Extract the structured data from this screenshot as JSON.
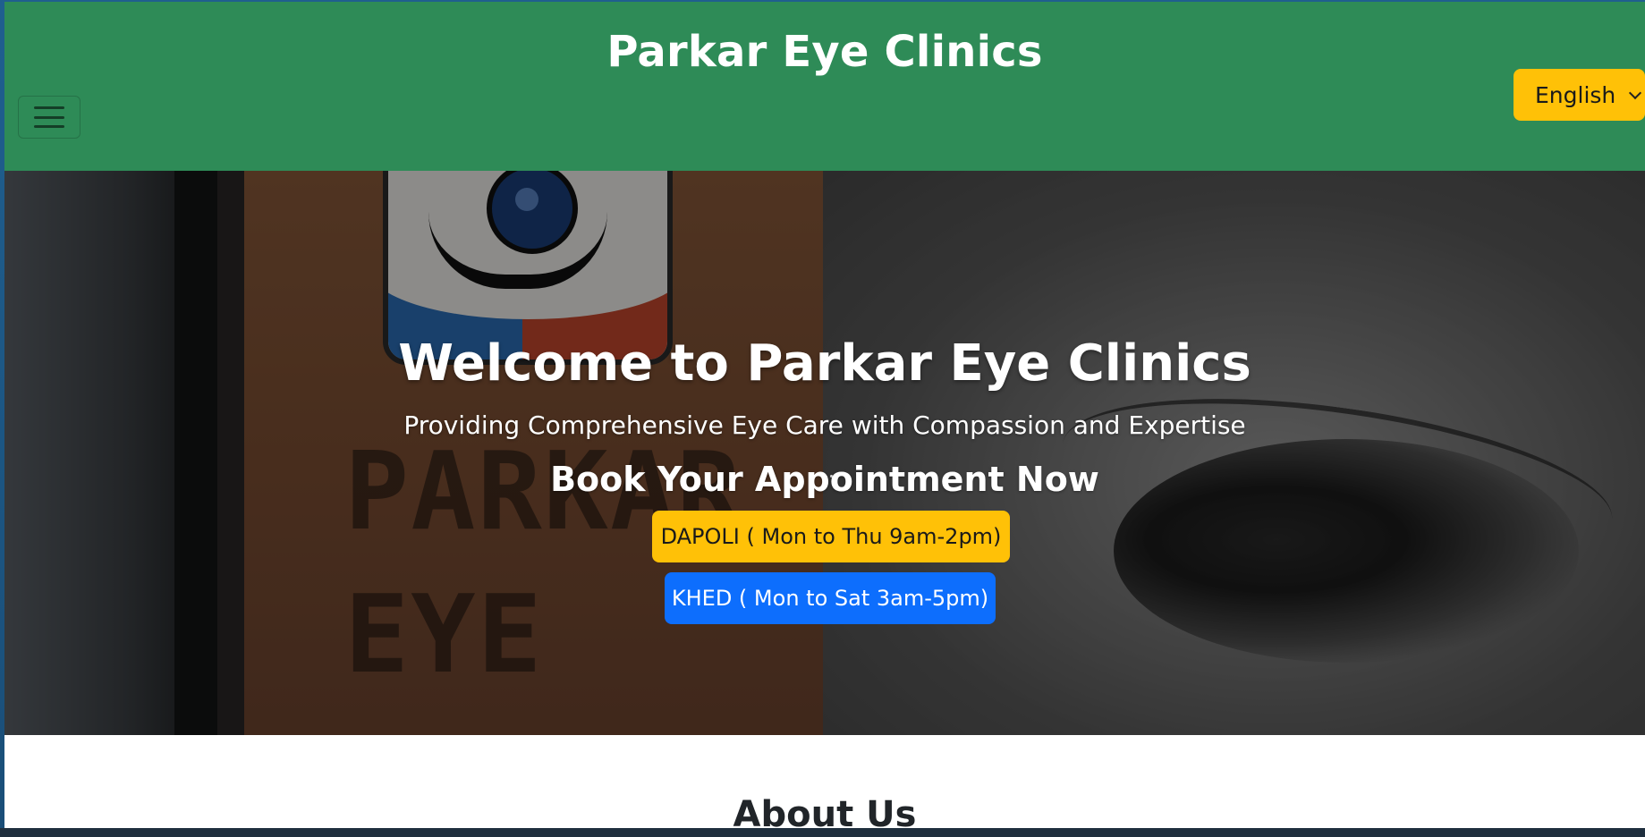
{
  "header": {
    "site_title": "Parkar Eye Clinics",
    "menu_toggle_icon": "hamburger-menu-icon",
    "language_select": {
      "selected": "English"
    },
    "background_color": "#2e8b57"
  },
  "hero": {
    "title": "Welcome to Parkar Eye Clinics",
    "subtitle": "Providing Comprehensive Eye Care with Compassion and Expertise",
    "cta_heading": "Book Your Appointment Now",
    "buttons": {
      "dapoli": {
        "label": "DAPOLI ( Mon to Thu 9am-2pm)",
        "color": "#ffc107"
      },
      "khed": {
        "label": "KHED ( Mon to Sat 3am-5pm)",
        "color": "#0d6efd"
      }
    },
    "sign_lettering": "PARKAR EYE"
  },
  "about": {
    "title": "About Us"
  }
}
